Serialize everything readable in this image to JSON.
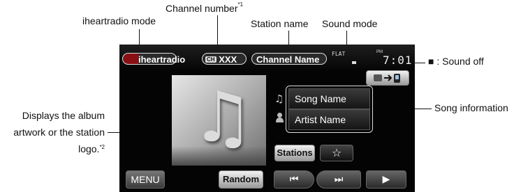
{
  "annotations": {
    "iheartradio_mode": "iheartradio mode",
    "channel_number": "Channel number",
    "channel_number_note": "*1",
    "station_name": "Station name",
    "sound_mode": "Sound mode",
    "sound_off": "■ : Sound off",
    "album_artwork": "Displays the album artwork or the station logo.",
    "album_artwork_line1": "Displays the album",
    "album_artwork_line2": "artwork or the station",
    "album_artwork_line3": "logo.",
    "album_artwork_note": "*2",
    "song_information": "Song information"
  },
  "screen": {
    "logo_text": "iheartradio",
    "channel_badge": "CH",
    "channel_number": "XXX",
    "channel_name": "Channel Name",
    "sound_mode": "FLAT",
    "clock_ampm": "PM",
    "clock_time": "7:01",
    "song_name": "Song Name",
    "artist_name": "Artist Name",
    "stations_label": "Stations",
    "favorite_symbol": "☆",
    "menu_label": "MENU",
    "random_label": "Random",
    "prev_symbol": "⏮",
    "next_symbol": "⏭",
    "play_symbol": "▶",
    "music_note_symbol": "♫",
    "colors": {
      "screen_bg": "#040404",
      "button_grey": "#c8c8c8",
      "logo_red": "#c0151b"
    },
    "icons": [
      "music-note-icon",
      "artist-icon",
      "source-switch-icon",
      "sound-off-indicator"
    ]
  }
}
